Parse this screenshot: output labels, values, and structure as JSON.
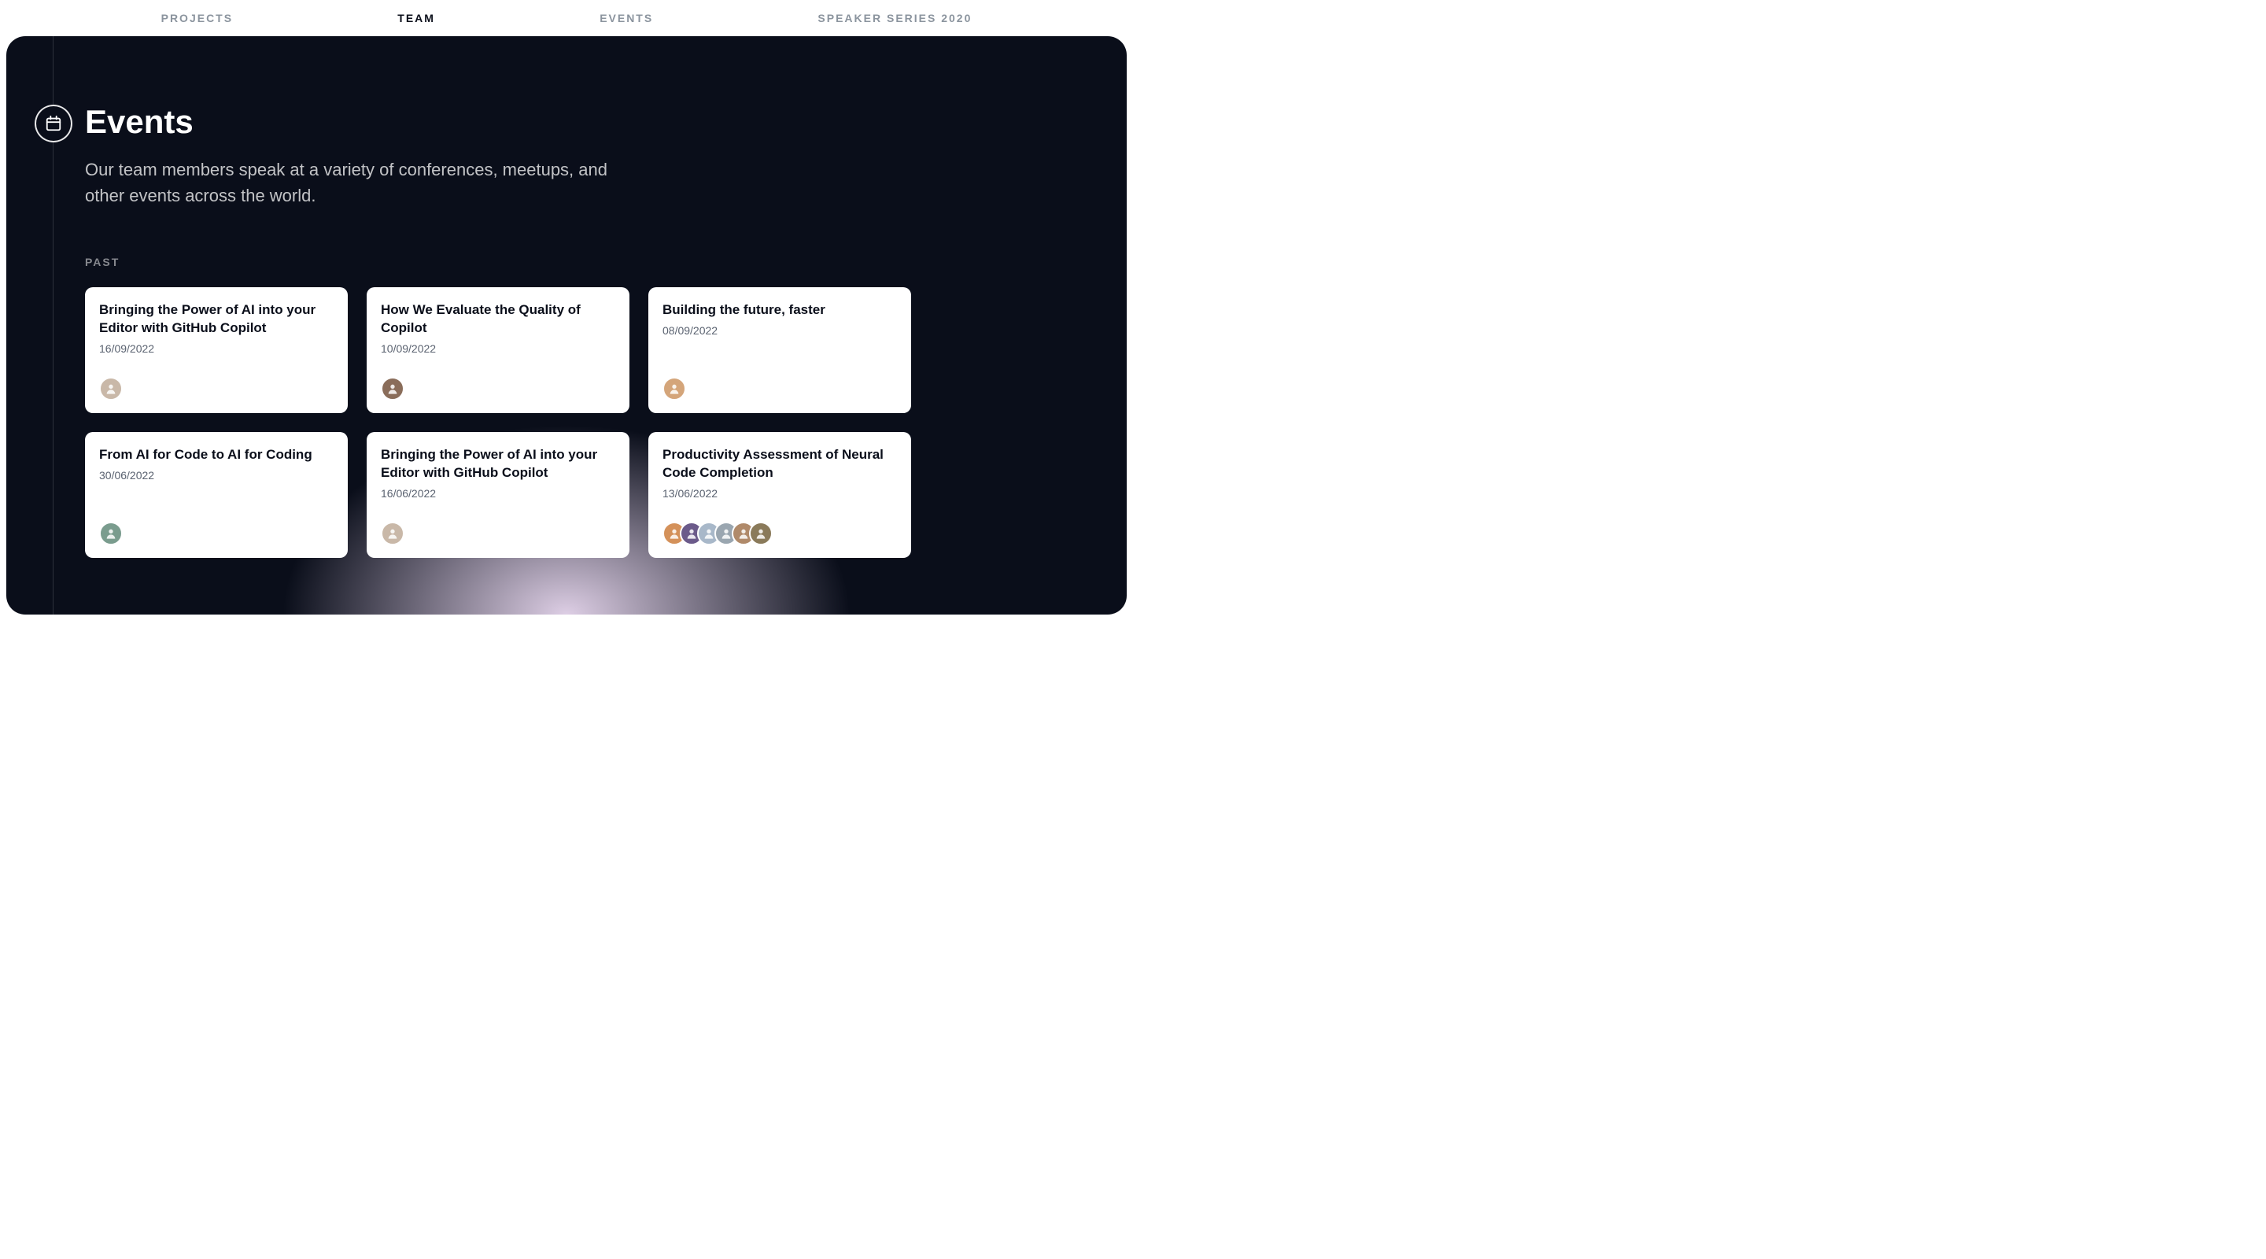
{
  "nav": {
    "items": [
      {
        "label": "PROJECTS",
        "active": false
      },
      {
        "label": "TEAM",
        "active": true
      },
      {
        "label": "EVENTS",
        "active": false
      },
      {
        "label": "SPEAKER SERIES 2020",
        "active": false
      }
    ]
  },
  "section": {
    "icon": "calendar-icon",
    "title": "Events",
    "subtitle": "Our team members speak at a variety of conferences, meetups, and other events across the world.",
    "subsection_label": "PAST"
  },
  "events": [
    {
      "title": "Bringing the Power of AI into your Editor with GitHub Copilot",
      "date": "16/09/2022",
      "avatars": [
        {
          "bg": "#c9b8a8"
        }
      ]
    },
    {
      "title": "How We Evaluate the Quality of Copilot",
      "date": "10/09/2022",
      "avatars": [
        {
          "bg": "#8a6d5a"
        }
      ]
    },
    {
      "title": "Building the future, faster",
      "date": "08/09/2022",
      "avatars": [
        {
          "bg": "#d4a57a"
        }
      ]
    },
    {
      "title": "From AI for Code to AI for Coding",
      "date": "30/06/2022",
      "avatars": [
        {
          "bg": "#7a9c8e"
        }
      ]
    },
    {
      "title": "Bringing the Power of AI into your Editor with GitHub Copilot",
      "date": "16/06/2022",
      "avatars": [
        {
          "bg": "#c9b8a8"
        }
      ]
    },
    {
      "title": "Productivity Assessment of Neural Code Completion",
      "date": "13/06/2022",
      "avatars": [
        {
          "bg": "#d4915a"
        },
        {
          "bg": "#6b5a8a"
        },
        {
          "bg": "#a8b8c9"
        },
        {
          "bg": "#9aa6b0"
        },
        {
          "bg": "#b08a6a"
        },
        {
          "bg": "#8a7a5a"
        }
      ]
    }
  ]
}
